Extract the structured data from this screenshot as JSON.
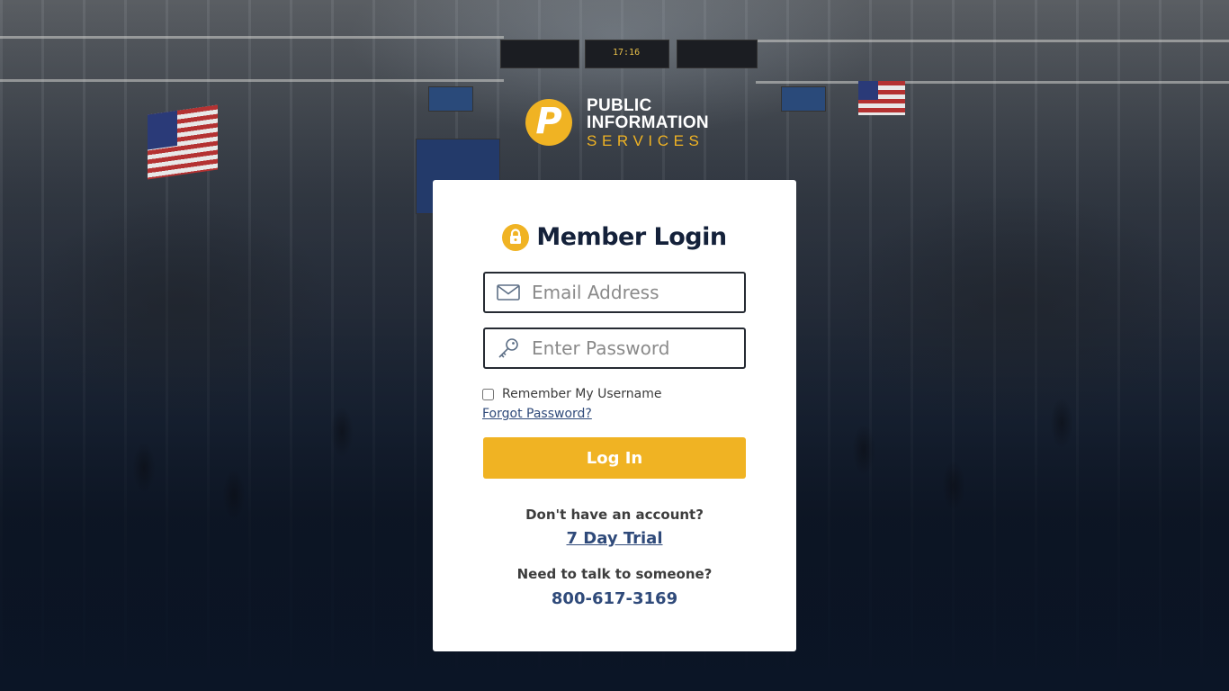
{
  "brand": {
    "logo_letter": "P",
    "line1": "PUBLIC",
    "line2": "INFORMATION",
    "line3": "SERVICES",
    "accent_color": "#f0b323"
  },
  "background": {
    "board_text": "17:16"
  },
  "login": {
    "title": "Member Login",
    "email_placeholder": "Email Address",
    "password_placeholder": "Enter Password",
    "remember_label": "Remember My Username",
    "forgot_label": "Forgot Password?",
    "submit_label": "Log In"
  },
  "signup": {
    "question": "Don't have an account?",
    "trial_label": "7 Day Trial"
  },
  "contact": {
    "question": "Need to talk to someone?",
    "phone": "800-617-3169"
  },
  "icons": {
    "lock": "lock-icon",
    "email": "envelope-icon",
    "password": "key-icon"
  }
}
